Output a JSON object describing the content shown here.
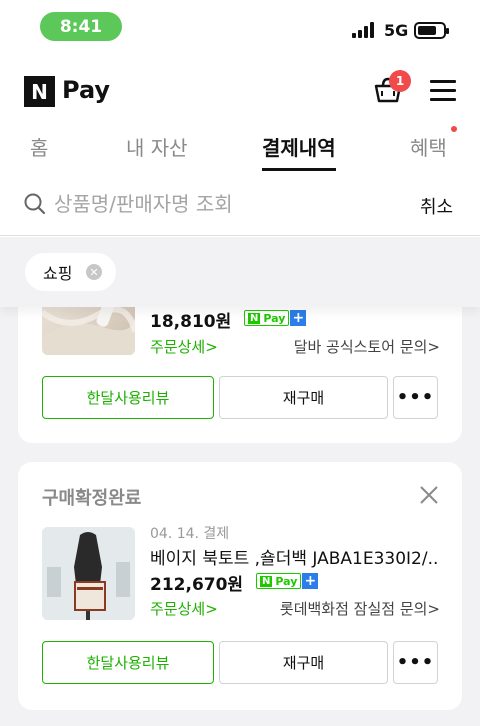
{
  "status_bar": {
    "time": "8:41",
    "network": "5G"
  },
  "header": {
    "logo_letter": "N",
    "logo_text": "Pay",
    "cart_count": "1"
  },
  "tabs": [
    {
      "label": "홈"
    },
    {
      "label": "내 자산"
    },
    {
      "label": "결제내역"
    },
    {
      "label": "혜택"
    }
  ],
  "search": {
    "placeholder": "상품명/판매자명 조회",
    "cancel_label": "취소"
  },
  "filter": {
    "chip_label": "쇼핑"
  },
  "orders": [
    {
      "price": "18,810원",
      "detail_label": "주문상세>",
      "store_label": "달바 공식스토어 문의>",
      "review_label": "한달사용리뷰",
      "rebuy_label": "재구매",
      "more_label": "•••"
    },
    {
      "status": "구매확정완료",
      "date": "04. 14. 결제",
      "title": "베이지 북토트 ,숄더백 JABA1E330I2/...",
      "price": "212,670원",
      "detail_label": "주문상세>",
      "store_label": "롯데백화점 잠실점 문의>",
      "review_label": "한달사용리뷰",
      "rebuy_label": "재구매",
      "more_label": "•••"
    }
  ],
  "npay_badge": {
    "n": "N",
    "text": "Pay",
    "plus": "+"
  },
  "colors": {
    "green": "#1db100",
    "naver_green": "#1ec800",
    "badge_red": "#f04a4a",
    "time_pill": "#5cc85a"
  }
}
